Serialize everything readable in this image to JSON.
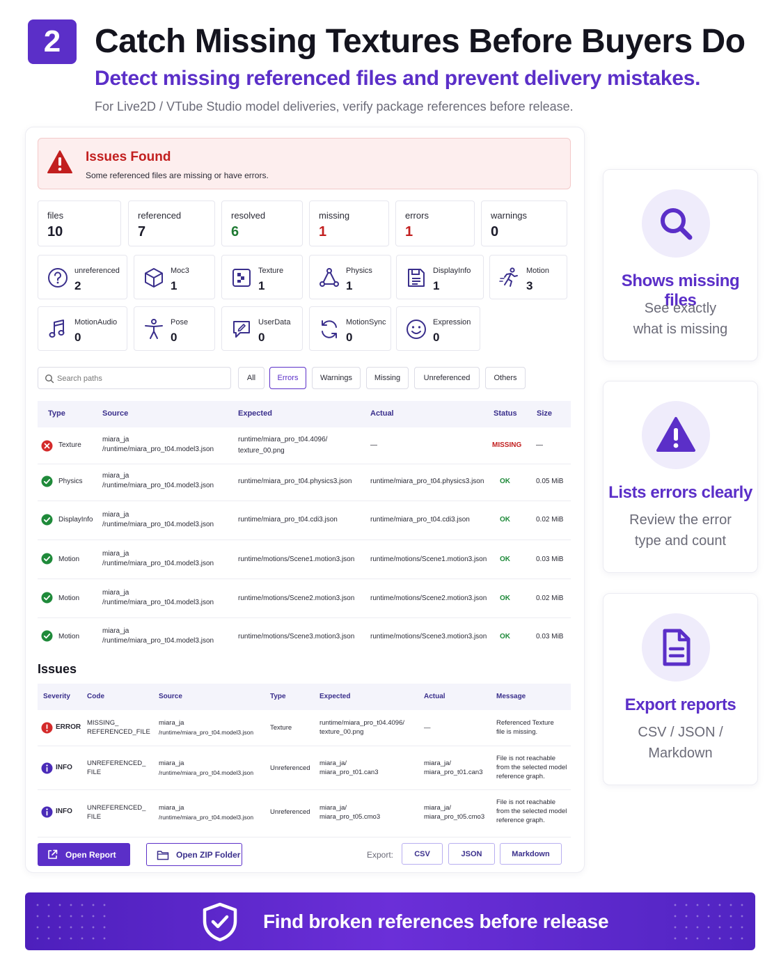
{
  "header": {
    "step": "2",
    "title": "Catch Missing Textures Before Buyers Do",
    "subtitle": "Detect missing referenced files and prevent delivery mistakes.",
    "description": "For Live2D / VTube Studio model deliveries, verify package references before release."
  },
  "alert": {
    "title": "Issues Found",
    "message": "Some referenced files are missing or have errors."
  },
  "stats": [
    {
      "label": "files",
      "value": "10"
    },
    {
      "label": "referenced",
      "value": "7"
    },
    {
      "label": "resolved",
      "value": "6"
    },
    {
      "label": "missing",
      "value": "1"
    },
    {
      "label": "errors",
      "value": "1"
    },
    {
      "label": "warnings",
      "value": "0"
    }
  ],
  "categories": [
    {
      "label": "unreferenced",
      "value": "2",
      "icon": "question-icon"
    },
    {
      "label": "Moc3",
      "value": "1",
      "icon": "cube-icon"
    },
    {
      "label": "Texture",
      "value": "1",
      "icon": "texture-icon"
    },
    {
      "label": "Physics",
      "value": "1",
      "icon": "physics-icon"
    },
    {
      "label": "DisplayInfo",
      "value": "1",
      "icon": "display-info-icon"
    },
    {
      "label": "Motion",
      "value": "3",
      "icon": "motion-icon"
    },
    {
      "label": "MotionAudio",
      "value": "0",
      "icon": "music-icon"
    },
    {
      "label": "Pose",
      "value": "0",
      "icon": "pose-icon"
    },
    {
      "label": "UserData",
      "value": "0",
      "icon": "user-data-icon"
    },
    {
      "label": "MotionSync",
      "value": "0",
      "icon": "sync-icon"
    },
    {
      "label": "Expression",
      "value": "0",
      "icon": "smile-icon"
    }
  ],
  "search": {
    "placeholder": "Search paths"
  },
  "filters": [
    "All",
    "Errors",
    "Warnings",
    "Missing",
    "Unreferenced",
    "Others"
  ],
  "files_table": {
    "headers": [
      "Type",
      "Source",
      "Expected",
      "Actual",
      "Status",
      "Size"
    ],
    "rows": [
      {
        "type": "Texture",
        "source1": "miara_ja",
        "source2": "/runtime/miara_pro_t04.model3.json",
        "expected1": "runtime/miara_pro_t04.4096/",
        "expected2": "texture_00.png",
        "actual": "—",
        "status": "MISSING",
        "size": "—"
      },
      {
        "type": "Physics",
        "source1": "miara_ja",
        "source2": "/runtime/miara_pro_t04.model3.json",
        "expected1": "runtime/miara_pro_t04.physics3.json",
        "expected2": "",
        "actual": "runtime/miara_pro_t04.physics3.json",
        "status": "OK",
        "size": "0.05 MiB"
      },
      {
        "type": "DisplayInfo",
        "source1": "miara_ja",
        "source2": "/runtime/miara_pro_t04.model3.json",
        "expected1": "runtime/miara_pro_t04.cdi3.json",
        "expected2": "",
        "actual": "runtime/miara_pro_t04.cdi3.json",
        "status": "OK",
        "size": "0.02 MiB"
      },
      {
        "type": "Motion",
        "source1": "miara_ja",
        "source2": "/runtime/miara_pro_t04.model3.json",
        "expected1": "runtime/motions/Scene1.motion3.json",
        "expected2": "",
        "actual": "runtime/motions/Scene1.motion3.json",
        "status": "OK",
        "size": "0.03 MiB"
      },
      {
        "type": "Motion",
        "source1": "miara_ja",
        "source2": "/runtime/miara_pro_t04.model3.json",
        "expected1": "runtime/motions/Scene2.motion3.json",
        "expected2": "",
        "actual": "runtime/motions/Scene2.motion3.json",
        "status": "OK",
        "size": "0.02 MiB"
      },
      {
        "type": "Motion",
        "source1": "miara_ja",
        "source2": "/runtime/miara_pro_t04.model3.json",
        "expected1": "runtime/motions/Scene3.motion3.json",
        "expected2": "",
        "actual": "runtime/motions/Scene3.motion3.json",
        "status": "OK",
        "size": "0.03 MiB"
      }
    ]
  },
  "issues": {
    "heading": "Issues",
    "headers": [
      "Severity",
      "Code",
      "Source",
      "Type",
      "Expected",
      "Actual",
      "Message"
    ],
    "rows": [
      {
        "severity": "ERROR",
        "code1": "MISSING_",
        "code2": "REFERENCED_FILE",
        "source1": "miara_ja",
        "source2": "/runtime/miara_pro_t04.model3.json",
        "type": "Texture",
        "expected1": "runtime/miara_pro_t04.4096/",
        "expected2": "texture_00.png",
        "actual1": "—",
        "actual2": "",
        "msg1": "Referenced Texture",
        "msg2": "file is missing.",
        "msg3": ""
      },
      {
        "severity": "INFO",
        "code1": "UNREFERENCED_",
        "code2": "FILE",
        "source1": "miara_ja",
        "source2": "/runtime/miara_pro_t04.model3.json",
        "type": "Unreferenced",
        "expected1": "miara_ja/",
        "expected2": "miara_pro_t01.can3",
        "actual1": "miara_ja/",
        "actual2": "miara_pro_t01.can3",
        "msg1": "File is not reachable",
        "msg2": "from the selected model",
        "msg3": "reference graph."
      },
      {
        "severity": "INFO",
        "code1": "UNREFERENCED_",
        "code2": "FILE",
        "source1": "miara_ja",
        "source2": "/runtime/miara_pro_t04.model3.json",
        "type": "Unreferenced",
        "expected1": "miara_ja/",
        "expected2": "miara_pro_t05.cmo3",
        "actual1": "miara_ja/",
        "actual2": "miara_pro_t05.cmo3",
        "msg1": "File is not reachable",
        "msg2": "from the selected model",
        "msg3": "reference graph."
      }
    ]
  },
  "actions": {
    "open_report": "Open Report",
    "open_zip": "Open ZIP Folder",
    "export_label": "Export:",
    "export_csv": "CSV",
    "export_json": "JSON",
    "export_markdown": "Markdown"
  },
  "features": [
    {
      "title": "Shows missing files",
      "line1": "See exactly",
      "line2": "what is missing",
      "icon": "search-icon"
    },
    {
      "title": "Lists errors clearly",
      "line1": "Review the error",
      "line2": "type and count",
      "icon": "warning-icon"
    },
    {
      "title": "Export reports",
      "line1": "CSV / JSON /",
      "line2": "Markdown",
      "icon": "document-icon"
    }
  ],
  "banner": {
    "text": "Find broken references before release",
    "icon": "shield-check-icon"
  },
  "colors": {
    "accent": "#5b2fc8",
    "error": "#c21f1f",
    "ok": "#1f8a3a",
    "alert_bg": "#fdeeee"
  }
}
